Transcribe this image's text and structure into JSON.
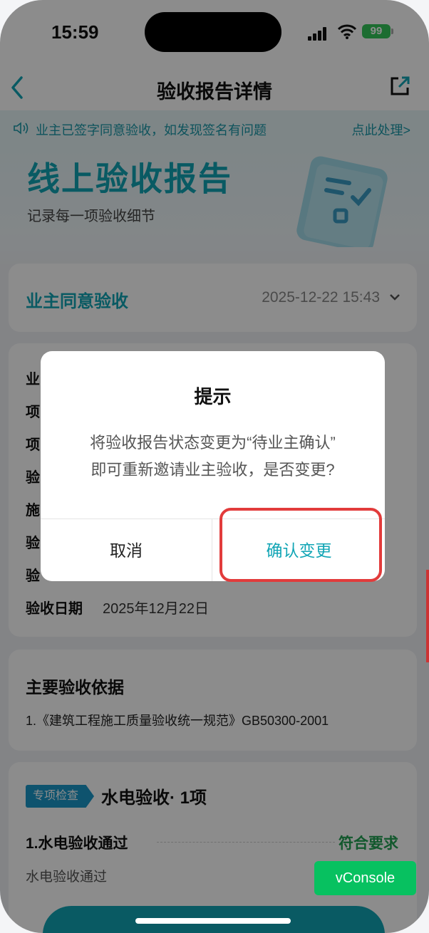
{
  "status_bar": {
    "time": "15:59",
    "battery": "99"
  },
  "nav": {
    "title": "验收报告详情"
  },
  "notice": {
    "text": "业主已签字同意验收，如发现签名有问题",
    "link": "点此处理>"
  },
  "banner": {
    "title": "线上验收报告",
    "subtitle": "记录每一项验收细节"
  },
  "status_card": {
    "label": "业主同意验收",
    "datetime": "2025-12-22 15:43"
  },
  "info": {
    "rows": [
      {
        "key": "业"
      },
      {
        "key": "项"
      },
      {
        "key": "项"
      },
      {
        "key": "验"
      },
      {
        "key": "施"
      },
      {
        "key": "验"
      },
      {
        "key": "验"
      },
      {
        "key": "验收日期",
        "value": "2025年12月22日"
      }
    ]
  },
  "basis": {
    "title": "主要验收依据",
    "item": "1.《建筑工程施工质量验收统一规范》GB50300-2001"
  },
  "check": {
    "tag": "专项检查",
    "title": "水电验收· 1项",
    "item": "1.水电验收通过",
    "result": "符合要求",
    "desc": "水电验收通过"
  },
  "vconsole": {
    "label": "vConsole"
  },
  "dialog": {
    "title": "提示",
    "line1": "将验收报告状态变更为“待业主确认”",
    "line2": "即可重新邀请业主验收，是否变更?",
    "cancel": "取消",
    "confirm": "确认变更"
  },
  "colors": {
    "accent": "#11a5b5",
    "success": "#22a052",
    "highlight": "#e23b3b",
    "vconsole": "#07c160"
  }
}
